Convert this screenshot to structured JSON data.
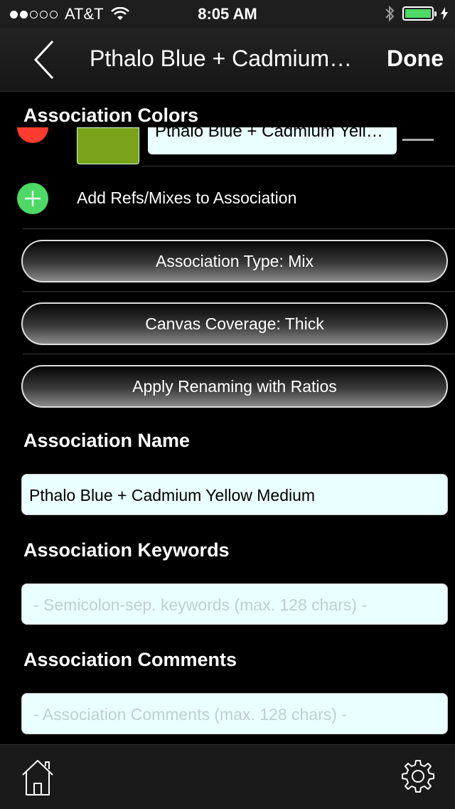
{
  "status_bar": {
    "carrier": "AT&T",
    "time": "8:05 AM",
    "signal_bars_filled": 2,
    "signal_bars_total": 5,
    "battery_level": 1.0,
    "battery_color": "#4cd964"
  },
  "nav": {
    "title": "Pthalo Blue + Cadmium…",
    "done_label": "Done",
    "back_icon": "chevron-left-icon"
  },
  "colors_section": {
    "title": "Association Colors",
    "items": [
      {
        "name": "Pthalo Blue + Cadmium Yell…",
        "swatch_color": "#7aa21a"
      }
    ],
    "add_label": "Add Refs/Mixes to Association"
  },
  "buttons": {
    "type": "Association Type: Mix",
    "coverage": "Canvas Coverage: Thick",
    "renaming": "Apply Renaming with Ratios"
  },
  "name_section": {
    "title": "Association Name",
    "value": "Pthalo Blue + Cadmium Yellow Medium"
  },
  "keywords_section": {
    "title": "Association Keywords",
    "placeholder": "- Semicolon-sep. keywords (max. 128 chars) -"
  },
  "comments_section": {
    "title": "Association Comments",
    "placeholder": "- Association Comments (max. 128 chars) -"
  },
  "tab_bar": {
    "home_icon": "home-icon",
    "settings_icon": "gear-icon"
  }
}
